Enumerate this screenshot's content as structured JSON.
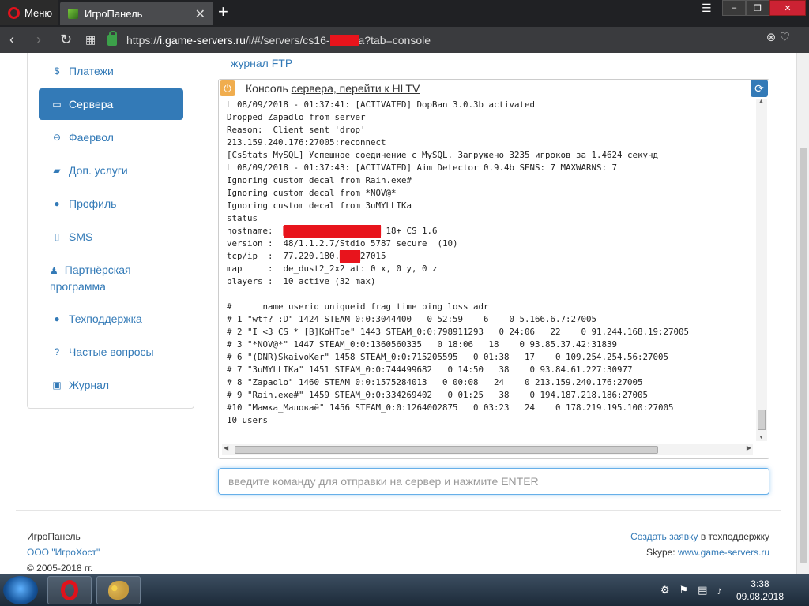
{
  "browser": {
    "menu_label": "Меню",
    "tab_title": "ИгроПанель",
    "url_prefix": "https://",
    "url_host": "i.game-servers.ru",
    "url_path_start": "/i/#/servers/cs16-",
    "url_path_end": "a?tab=console"
  },
  "sidebar": {
    "items": [
      {
        "icon": "dollar-icon",
        "label": "Платежи"
      },
      {
        "icon": "server-icon",
        "label": "Сервера"
      },
      {
        "icon": "firewall-icon",
        "label": "Фаервол"
      },
      {
        "icon": "folder-icon",
        "label": "Доп. услуги"
      },
      {
        "icon": "user-icon",
        "label": "Профиль"
      },
      {
        "icon": "mobile-icon",
        "label": "SMS"
      },
      {
        "icon": "partners-icon",
        "label": "Партнёрская программа"
      },
      {
        "icon": "support-icon",
        "label": "Техподдержка"
      },
      {
        "icon": "question-icon",
        "label": "Частые вопросы"
      },
      {
        "icon": "journal-icon",
        "label": "Журнал"
      }
    ],
    "active_index": 1
  },
  "main": {
    "ftp_link": "журнал FTP",
    "console_title_prefix": "Консоль ",
    "console_title_link": "сервера, перейти к HLTV",
    "console_lines": [
      "L 08/09/2018 - 01:37:41: [ACTIVATED] DopBan 3.0.3b activated",
      "Dropped Zapadlo from server",
      "Reason:  Client sent 'drop'",
      "213.159.240.176:27005:reconnect",
      "[CsStats MySQL] Успешное соединение с MySQL. Загружено 3235 игроков за 1.4624 секунд",
      "L 08/09/2018 - 01:37:43: [ACTIVATED] Aim Detector 0.9.4b SENS: 7 MAXWARNS: 7",
      "Ignoring custom decal from Rain.exe#",
      "Ignoring custom decal from *NOV@*",
      "Ignoring custom decal from 3uMYLLIKa",
      "status",
      "hostname:  ███████████████████ 18+ CS 1.6",
      "version :  48/1.1.2.7/Stdio 5787 secure  (10)",
      "tcp/ip  :  77.220.180.████27015",
      "map     :  de_dust2_2x2 at: 0 x, 0 y, 0 z",
      "players :  10 active (32 max)",
      "",
      "#      name userid uniqueid frag time ping loss adr",
      "# 1 \"wtf? :D\" 1424 STEAM_0:0:3044400   0 52:59    6    0 5.166.6.7:27005",
      "# 2 \"I <3 CS * [B]КоНТре\" 1443 STEAM_0:0:798911293   0 24:06   22    0 91.244.168.19:27005",
      "# 3 \"*NOV@*\" 1447 STEAM_0:0:1360560335   0 18:06   18    0 93.85.37.42:31839",
      "# 6 \"(DNR)SkaivoKer\" 1458 STEAM_0:0:715205595   0 01:38   17    0 109.254.254.56:27005",
      "# 7 \"3uMYLLIKa\" 1451 STEAM_0:0:744499682   0 14:50   38    0 93.84.61.227:30977",
      "# 8 \"Zapadlo\" 1460 STEAM_0:0:1575284013   0 00:08   24    0 213.159.240.176:27005",
      "# 9 \"Rain.exe#\" 1459 STEAM_0:0:334269402   0 01:25   38    0 194.187.218.186:27005",
      "#10 \"Мамка_Маловаё\" 1456 STEAM_0:0:1264002875   0 03:23   24    0 178.219.195.100:27005",
      "10 users"
    ],
    "command_placeholder": "введите команду для отправки на сервер и нажмите ENTER"
  },
  "footer": {
    "brand": "ИгроПанель",
    "company": "ООО \"ИгроХост\"",
    "copyright": "© 2005-2018 гг.",
    "support_link": "Создать заявку",
    "support_suffix": " в техподдержку",
    "skype_label": "Skype: ",
    "skype_link": "www.game-servers.ru"
  },
  "taskbar": {
    "time": "3:38",
    "date": "09.08.2018"
  },
  "colors": {
    "primary": "#337ab7",
    "warning": "#f0ad4e",
    "redaction": "#e8141c"
  }
}
